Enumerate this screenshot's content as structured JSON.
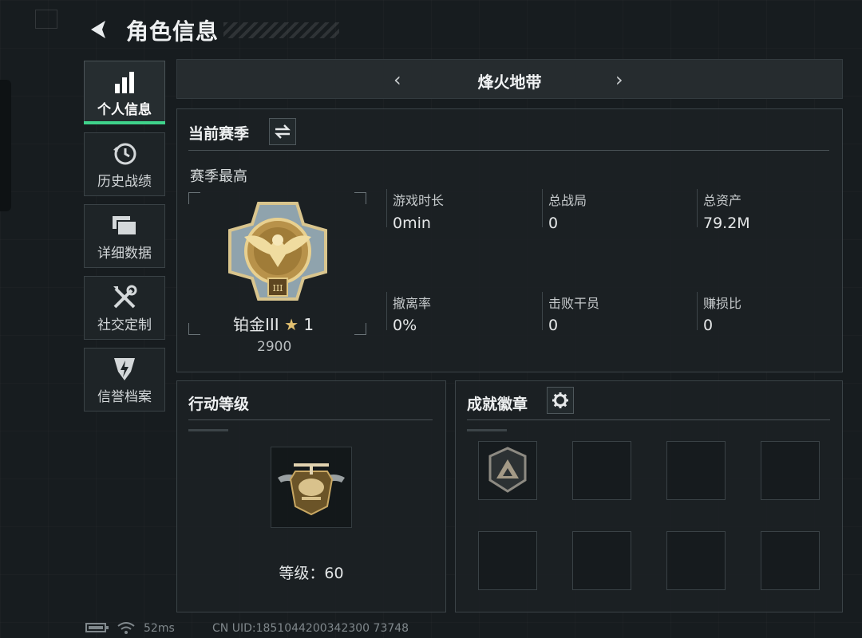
{
  "header": {
    "title": "角色信息"
  },
  "sidebar": {
    "items": [
      {
        "label": "个人信息",
        "icon": "bar-chart-icon",
        "active": true
      },
      {
        "label": "历史战绩",
        "icon": "history-clock-icon",
        "active": false
      },
      {
        "label": "详细数据",
        "icon": "folders-icon",
        "active": false
      },
      {
        "label": "社交定制",
        "icon": "tools-icon",
        "active": false
      },
      {
        "label": "信誉档案",
        "icon": "shield-bolt-icon",
        "active": false
      }
    ],
    "accent_color": "#3fd28b"
  },
  "mode_selector": {
    "label": "烽火地带"
  },
  "season": {
    "title": "当前赛季",
    "subtitle": "赛季最高",
    "rank_name": "铂金III",
    "star_count": "1",
    "rank_points": "2900",
    "stats": [
      {
        "label": "游戏时长",
        "value": "0min"
      },
      {
        "label": "总战局",
        "value": "0"
      },
      {
        "label": "总资产",
        "value": "79.2M"
      },
      {
        "label": "撤离率",
        "value": "0%"
      },
      {
        "label": "击败干员",
        "value": "0"
      },
      {
        "label": "赚损比",
        "value": "0"
      }
    ]
  },
  "action_level": {
    "title": "行动等级",
    "level_text": "等级：60"
  },
  "achievements": {
    "title": "成就徽章"
  },
  "status_bar": {
    "ping": "52ms",
    "uid": "CN UID:1851044200342300 73748"
  }
}
